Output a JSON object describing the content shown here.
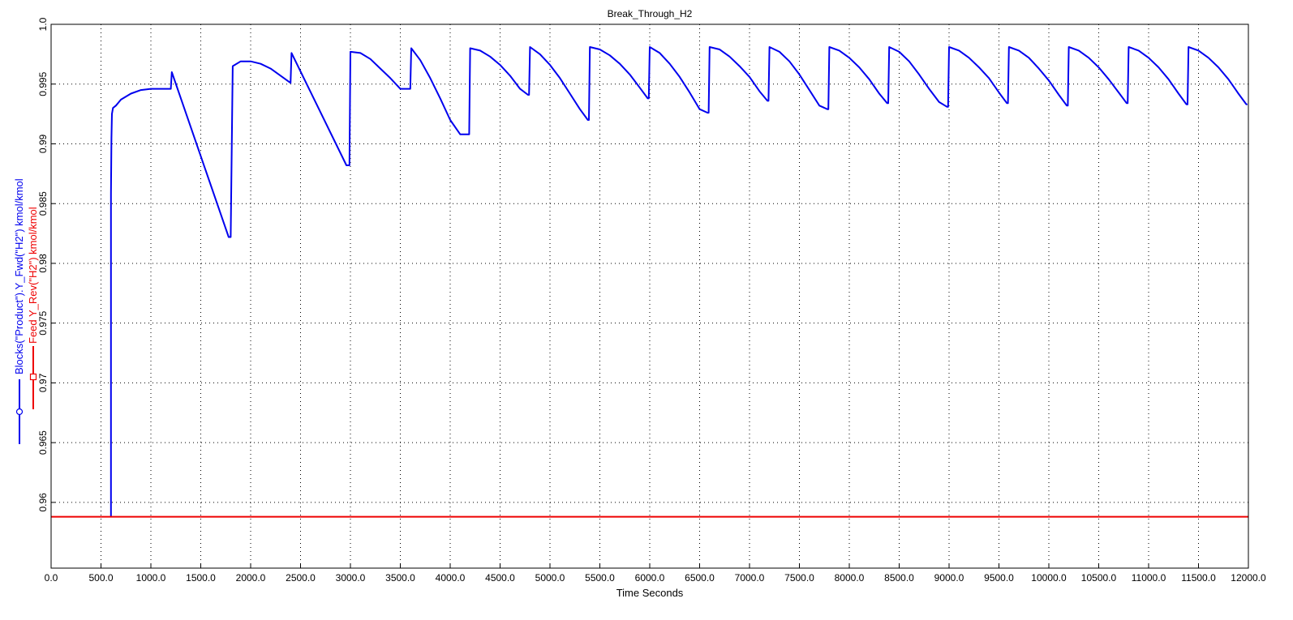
{
  "chart_data": {
    "type": "line",
    "title": "Break_Through_H2",
    "xlabel": "Time Seconds",
    "xlim": [
      0,
      12000
    ],
    "ylim": [
      0.9545,
      1.0
    ],
    "x_ticks": [
      "0.0",
      "500.0",
      "1000.0",
      "1500.0",
      "2000.0",
      "2500.0",
      "3000.0",
      "3500.0",
      "4000.0",
      "4500.0",
      "5000.0",
      "5500.0",
      "6000.0",
      "6500.0",
      "7000.0",
      "7500.0",
      "8000.0",
      "8500.0",
      "9000.0",
      "9500.0",
      "10000.0",
      "10500.0",
      "11000.0",
      "11500.0",
      "12000.0"
    ],
    "y_ticks": [
      "0.96",
      "0.965",
      "0.97",
      "0.975",
      "0.98",
      "0.985",
      "0.99",
      "0.995",
      "1.0"
    ],
    "grid": true,
    "series": [
      {
        "name": "Blocks(\"Product\").Y_Fwd(\"H2\") kmol/kmol",
        "color": "#0000ee",
        "marker": "circle",
        "x": [
          600,
          600,
          605,
          610,
          620,
          650,
          700,
          800,
          900,
          1000,
          1100,
          1200,
          1210,
          1780,
          1790,
          1800,
          1820,
          1900,
          2000,
          2100,
          2200,
          2300,
          2400,
          2410,
          2960,
          2990,
          3000,
          3100,
          3200,
          3300,
          3400,
          3500,
          3590,
          3600,
          3610,
          3700,
          3800,
          3900,
          4000,
          4100,
          4180,
          4190,
          4200,
          4300,
          4400,
          4500,
          4600,
          4700,
          4780,
          4790,
          4800,
          4900,
          5000,
          5100,
          5200,
          5300,
          5380,
          5390,
          5400,
          5500,
          5600,
          5700,
          5800,
          5900,
          5980,
          5990,
          6000,
          6100,
          6200,
          6300,
          6400,
          6500,
          6580,
          6590,
          6600,
          6700,
          6800,
          6900,
          7000,
          7100,
          7180,
          7190,
          7200,
          7300,
          7400,
          7500,
          7600,
          7700,
          7780,
          7790,
          7800,
          7900,
          8000,
          8100,
          8200,
          8300,
          8380,
          8390,
          8400,
          8500,
          8600,
          8700,
          8800,
          8900,
          8980,
          8990,
          9000,
          9100,
          9200,
          9300,
          9400,
          9500,
          9580,
          9590,
          9600,
          9700,
          9800,
          9900,
          10000,
          10100,
          10180,
          10190,
          10200,
          10300,
          10400,
          10500,
          10600,
          10700,
          10780,
          10790,
          10800,
          10900,
          11000,
          11100,
          11200,
          11300,
          11380,
          11390,
          11400,
          11500,
          11600,
          11700,
          11800,
          11900,
          11980,
          11990
        ],
        "y": [
          0.9588,
          0.9858,
          0.9905,
          0.9925,
          0.993,
          0.9932,
          0.9937,
          0.9942,
          0.9945,
          0.9946,
          0.9946,
          0.9946,
          0.996,
          0.9822,
          0.9822,
          0.9822,
          0.9965,
          0.9969,
          0.9969,
          0.9967,
          0.9963,
          0.9957,
          0.9951,
          0.9976,
          0.9882,
          0.9882,
          0.9977,
          0.9976,
          0.9971,
          0.9963,
          0.9955,
          0.9946,
          0.9946,
          0.9946,
          0.998,
          0.997,
          0.9955,
          0.9938,
          0.992,
          0.9908,
          0.9908,
          0.9908,
          0.998,
          0.9978,
          0.9973,
          0.9966,
          0.9957,
          0.9946,
          0.9941,
          0.9941,
          0.9981,
          0.9975,
          0.9966,
          0.9955,
          0.9942,
          0.9929,
          0.992,
          0.992,
          0.9981,
          0.9979,
          0.9974,
          0.9967,
          0.9958,
          0.9947,
          0.9938,
          0.9938,
          0.9981,
          0.9976,
          0.9967,
          0.9956,
          0.9943,
          0.9929,
          0.9926,
          0.9926,
          0.9981,
          0.9979,
          0.9973,
          0.9965,
          0.9956,
          0.9944,
          0.9936,
          0.9936,
          0.9981,
          0.9977,
          0.9969,
          0.9958,
          0.9945,
          0.9932,
          0.9929,
          0.9929,
          0.9981,
          0.9978,
          0.9972,
          0.9964,
          0.9954,
          0.9942,
          0.9934,
          0.9934,
          0.9981,
          0.9977,
          0.9969,
          0.9958,
          0.9946,
          0.9935,
          0.9931,
          0.9931,
          0.9981,
          0.9978,
          0.9972,
          0.9964,
          0.9955,
          0.9943,
          0.9934,
          0.9934,
          0.9981,
          0.9978,
          0.9972,
          0.9963,
          0.9953,
          0.9941,
          0.9932,
          0.9932,
          0.9981,
          0.9978,
          0.9972,
          0.9964,
          0.9954,
          0.9943,
          0.9934,
          0.9934,
          0.9981,
          0.9978,
          0.9972,
          0.9964,
          0.9954,
          0.9942,
          0.9933,
          0.9933,
          0.9981,
          0.9978,
          0.9972,
          0.9964,
          0.9954,
          0.9942,
          0.9933,
          0.9933
        ]
      },
      {
        "name": "Feed Y_Rev(\"H2\") kmol/kmol",
        "color": "#ee0000",
        "marker": "square",
        "x": [
          0,
          12000
        ],
        "y": [
          0.9588,
          0.9588
        ]
      }
    ]
  }
}
